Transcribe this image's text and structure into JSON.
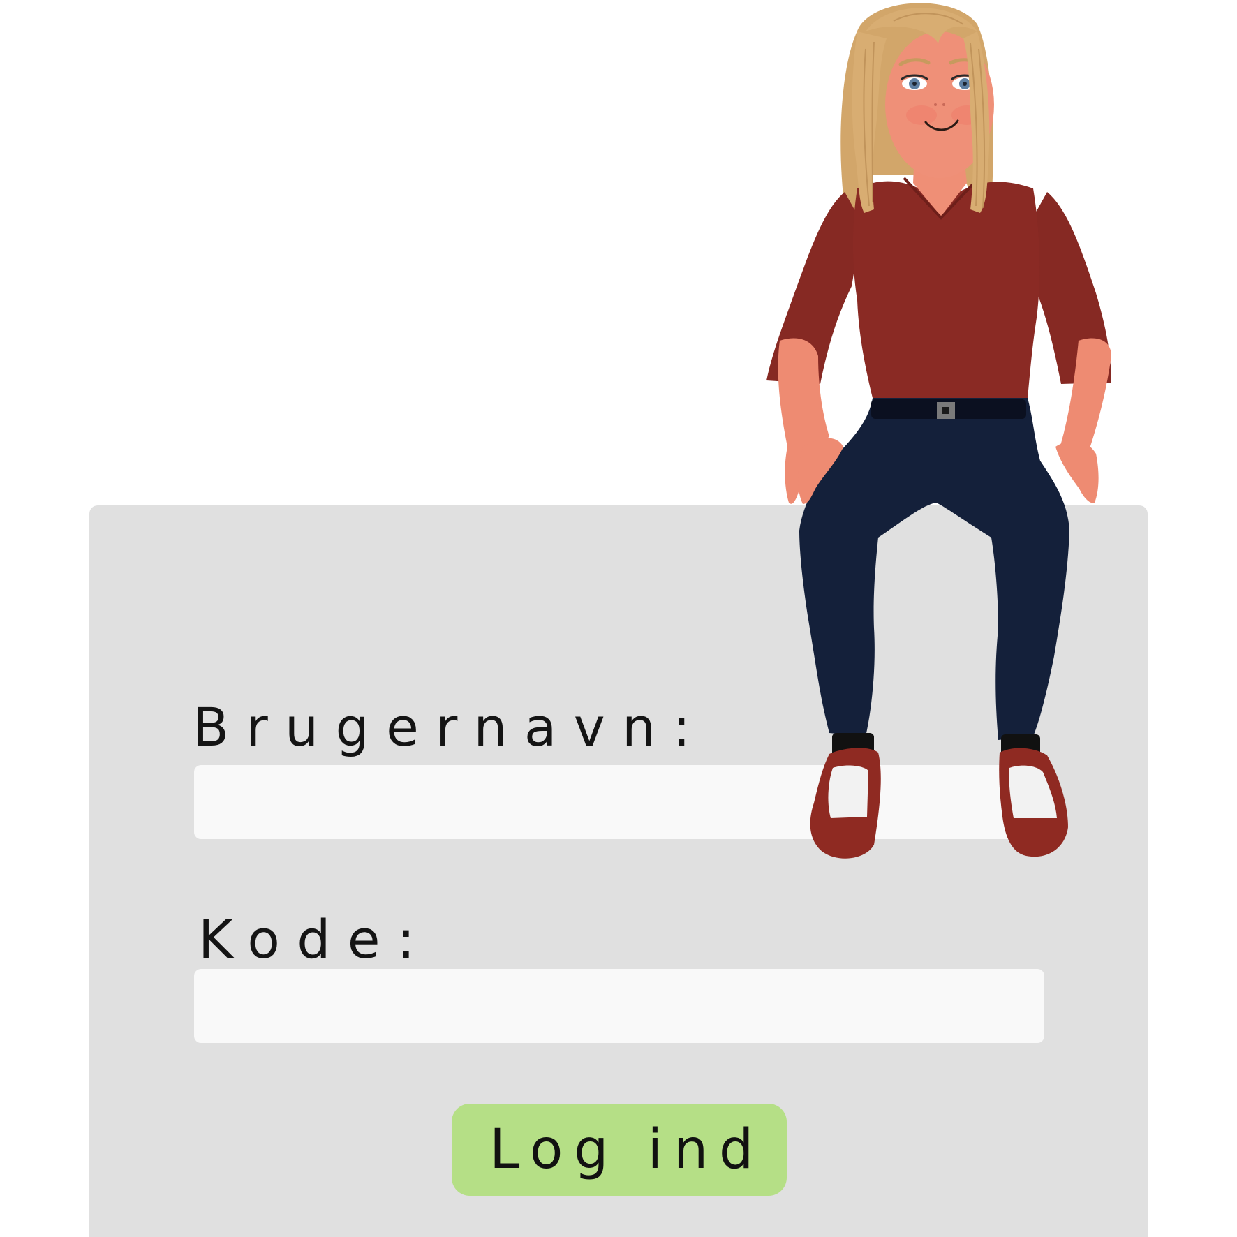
{
  "form": {
    "username_label": "Brugernavn:",
    "username_value": "",
    "password_label": "Kode:",
    "password_value": "",
    "submit_label": "Log ind"
  },
  "colors": {
    "card_background": "#e0e0e0",
    "input_background": "#f9f9f9",
    "button_background": "#b5df86",
    "shirt": "#8a2a24",
    "pants": "#14203a",
    "hair": "#d6ab70",
    "skin": "#ef8f76",
    "shoes": "#8f2a22"
  },
  "illustration": {
    "subject": "seated-girl-character"
  }
}
